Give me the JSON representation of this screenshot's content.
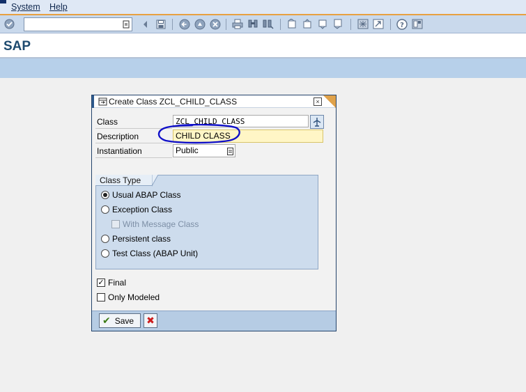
{
  "menubar": {
    "items": [
      {
        "label": "System",
        "underline": "S"
      },
      {
        "label": "Help",
        "underline": "H"
      }
    ]
  },
  "toolbar": {
    "command_field_value": "",
    "icons": [
      "enter-icon",
      "back-icon",
      "save-icon",
      "prev-icon",
      "exit-icon",
      "cancel-icon",
      "print-icon",
      "find-icon",
      "find-next-icon",
      "first-page-icon",
      "prev-page-icon",
      "next-page-icon",
      "last-page-icon",
      "new-session-icon",
      "shortcut-icon",
      "help-icon",
      "layout-icon"
    ]
  },
  "titlebar": {
    "title": "SAP"
  },
  "dialog": {
    "title": "Create Class ZCL_CHILD_CLASS",
    "close_glyph": "×",
    "fields": {
      "class_label": "Class",
      "class_value": "ZCL_CHILD_CLASS",
      "description_label": "Description",
      "description_value": "CHILD CLASS",
      "instantiation_label": "Instantiation",
      "instantiation_value": "Public"
    },
    "class_type": {
      "title": "Class Type",
      "options": [
        {
          "label": "Usual ABAP Class",
          "checked": true
        },
        {
          "label": "Exception Class",
          "checked": false
        },
        {
          "label": "With Message Class",
          "checked": false,
          "disabled": true
        },
        {
          "label": "Persistent class",
          "checked": false
        },
        {
          "label": "Test Class (ABAP Unit)",
          "checked": false
        }
      ]
    },
    "final_label": "Final",
    "final_checked": true,
    "only_modeled_label": "Only Modeled",
    "only_modeled_checked": false,
    "save_label": "Save"
  },
  "colors": {
    "accent": "#e8a040",
    "annotation": "#1010c8",
    "brand_title": "#1d4a6f"
  }
}
